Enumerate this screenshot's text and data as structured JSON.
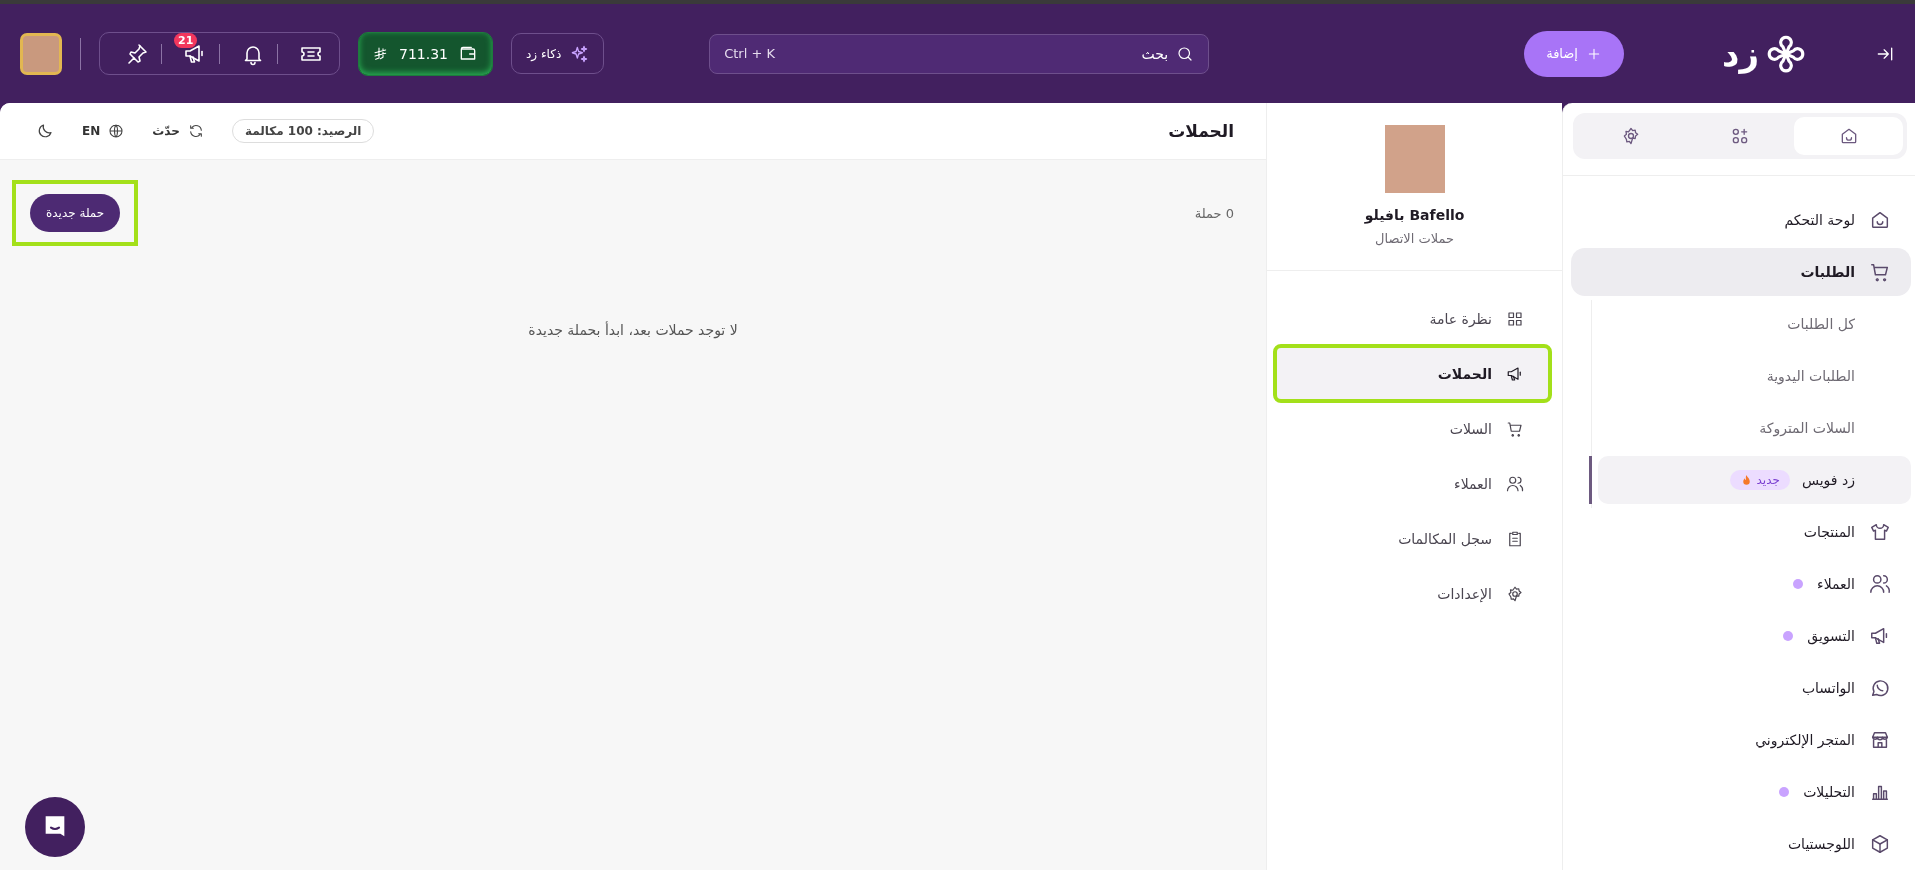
{
  "topbar": {
    "logo": {
      "text": "زد"
    },
    "add_button": {
      "label": "إضافة"
    },
    "search": {
      "placeholder": "بحث",
      "shortcut": "Ctrl + K"
    },
    "ai_button": {
      "label": "ذكاء زد"
    },
    "wallet": {
      "amount": "711.31"
    },
    "icon_buttons": [
      {
        "kind": "ticket"
      },
      {
        "kind": "bell"
      },
      {
        "kind": "megaphone",
        "badge": "21"
      },
      {
        "kind": "pin"
      }
    ]
  },
  "sidebar": {
    "tabs": [
      {
        "kind": "home",
        "selected": true
      },
      {
        "kind": "apps",
        "selected": false
      },
      {
        "kind": "gear",
        "selected": false
      }
    ],
    "items": [
      {
        "label": "لوحة التحكم",
        "kind": "home",
        "selected": false,
        "dot": false
      },
      {
        "label": "الطلبات",
        "kind": "cart",
        "selected": true,
        "dot": false,
        "expanded": true,
        "children": [
          {
            "label": "كل الطلبات",
            "selected": false
          },
          {
            "label": "الطلبات اليدوية",
            "selected": false
          },
          {
            "label": "السلات المتروكة",
            "selected": false
          },
          {
            "label": "زد فويس",
            "selected": true,
            "badge": "جديد"
          }
        ]
      },
      {
        "label": "المنتجات",
        "kind": "shirt",
        "selected": false,
        "dot": false
      },
      {
        "label": "العملاء",
        "kind": "users",
        "selected": false,
        "dot": true
      },
      {
        "label": "التسويق",
        "kind": "megaphone",
        "selected": false,
        "dot": true
      },
      {
        "label": "الواتساب",
        "kind": "whatsapp",
        "selected": false,
        "dot": false
      },
      {
        "label": "المتجر الإلكتروني",
        "kind": "store",
        "selected": false,
        "dot": false
      },
      {
        "label": "التحليلات",
        "kind": "chart",
        "selected": false,
        "dot": true
      },
      {
        "label": "اللوجستيات",
        "kind": "box",
        "selected": false,
        "dot": false
      }
    ]
  },
  "app_panel": {
    "name": "Bafello بافيلو",
    "subtitle": "حملات الاتصال",
    "items": [
      {
        "label": "نظرة عامة",
        "kind": "grid",
        "selected": false
      },
      {
        "label": "الحملات",
        "kind": "megaphone",
        "selected": true
      },
      {
        "label": "السلات",
        "kind": "cart",
        "selected": false
      },
      {
        "label": "العملاء",
        "kind": "users",
        "selected": false
      },
      {
        "label": "سجل المكالمات",
        "kind": "clipboard",
        "selected": false
      },
      {
        "label": "الإعدادات",
        "kind": "gear",
        "selected": false
      }
    ]
  },
  "main": {
    "title": "الحملات",
    "balance": "الرصيد: 100 مكالمة",
    "refresh": "حدّث",
    "language": "EN",
    "count": "0 حملة",
    "new_button": {
      "label": "حملة جديدة",
      "highlighted": true
    },
    "empty_message": "لا توجد حملات بعد، ابدأ بحملة جديدة"
  }
}
